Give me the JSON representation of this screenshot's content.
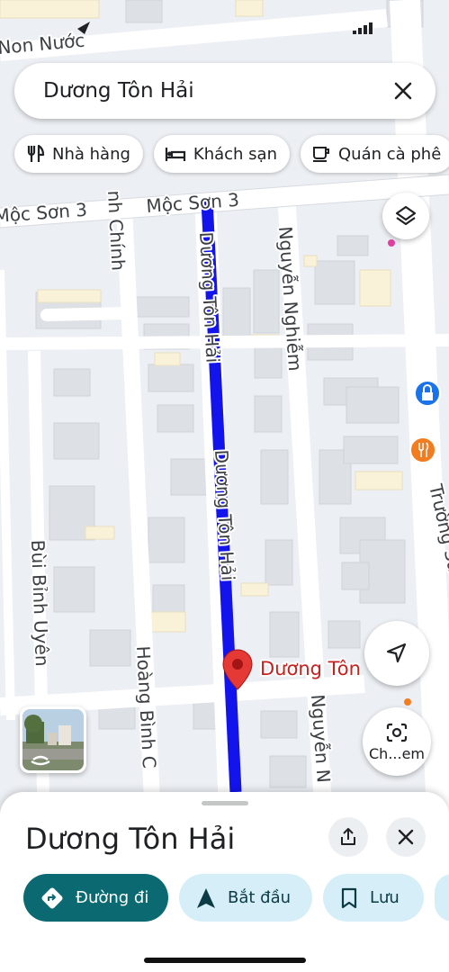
{
  "status_bar": {
    "area_label": "Non Nước"
  },
  "search": {
    "query": "Dương Tôn Hải"
  },
  "chips": [
    {
      "label": "Nhà hàng",
      "icon": "restaurant-icon"
    },
    {
      "label": "Khách sạn",
      "icon": "hotel-icon"
    },
    {
      "label": "Quán cà phê",
      "icon": "coffee-icon"
    }
  ],
  "map": {
    "streets": {
      "moc_son_3_left": "Mộc Sơn 3",
      "moc_son_3_right": "Mộc Sơn 3",
      "duong_ton_hai": "Dương Tôn Hải",
      "duong_ton_hai_lower": "Dương Tôn Hải",
      "nguyen_nghiem_top": "Nguyễn Nghiễm",
      "nguyen_nghiem_bottom": "Nguyễn N",
      "bui_binh_uyen": "Bùi Bỉnh Uyên",
      "hoang_binh_chinh": "Hoàng Bình C",
      "binh_chinh_top": "nh Chính",
      "truong_sa": "Trường Sa"
    },
    "pin_label": "Dương Tôn",
    "route_color": "#1a1aff",
    "pin_color": "#e53935"
  },
  "camera_button": {
    "label": "Ch...em"
  },
  "sheet": {
    "title": "Dương Tôn Hải",
    "actions": [
      {
        "label": "Đường đi",
        "icon": "directions-icon"
      },
      {
        "label": "Bắt đầu",
        "icon": "navigation-arrow-icon"
      },
      {
        "label": "Lưu",
        "icon": "bookmark-icon"
      }
    ]
  }
}
